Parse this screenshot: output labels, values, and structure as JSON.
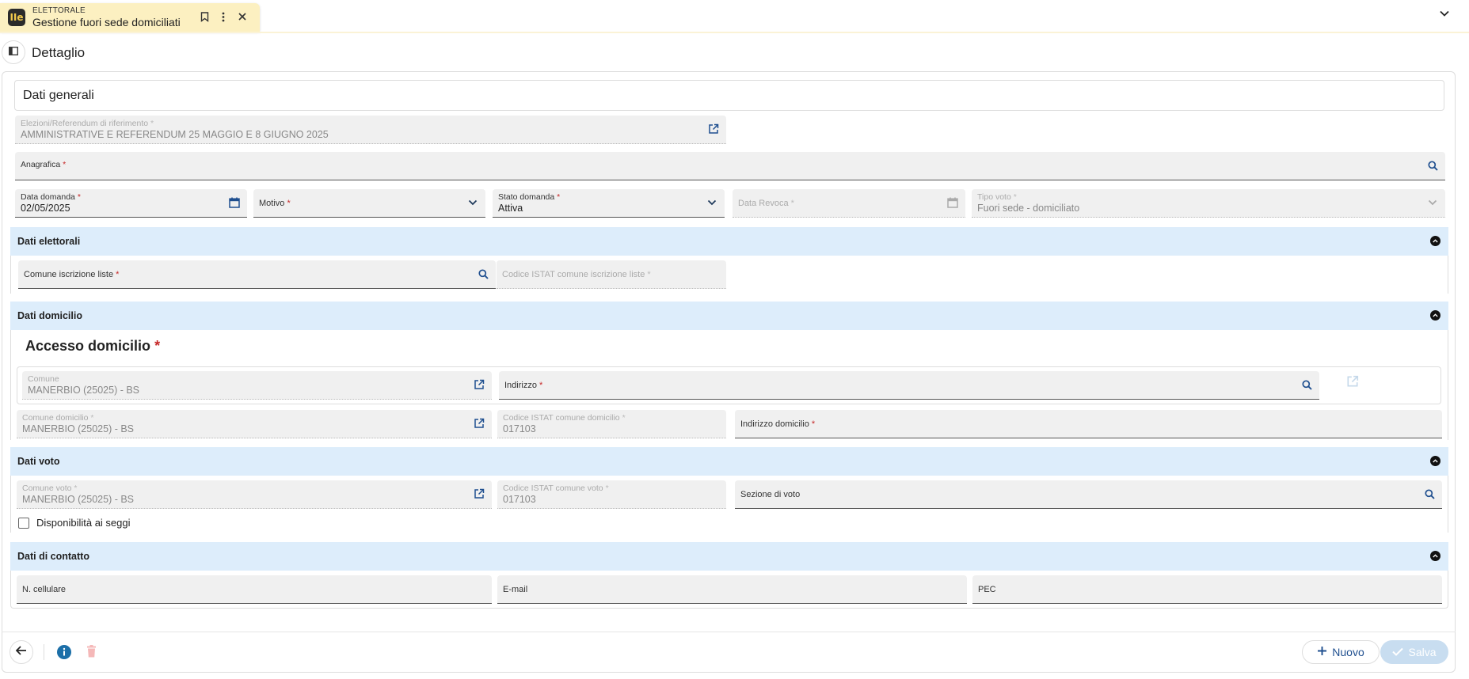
{
  "tab": {
    "category": "ELETTORALE",
    "title": "Gestione fuori sede domiciliati",
    "logo_text": "IIe"
  },
  "header": {
    "title": "Dettaglio"
  },
  "dati_generali": {
    "title": "Dati generali",
    "elezioni": {
      "label": "Elezioni/Referendum di riferimento",
      "value": "AMMINISTRATIVE E REFERENDUM 25 MAGGIO E 8 GIUGNO 2025"
    },
    "anagrafica": {
      "label": "Anagrafica"
    },
    "data_domanda": {
      "label": "Data domanda",
      "value": "02/05/2025"
    },
    "motivo": {
      "label": "Motivo"
    },
    "stato_domanda": {
      "label": "Stato domanda",
      "value": "Attiva"
    },
    "data_revoca": {
      "label": "Data Revoca"
    },
    "tipo_voto": {
      "label": "Tipo voto",
      "value": "Fuori sede - domiciliato"
    }
  },
  "dati_elettorali": {
    "title": "Dati elettorali",
    "comune_iscrizione": {
      "label": "Comune iscrizione liste"
    },
    "codice_istat_iscrizione": {
      "label": "Codice ISTAT comune iscrizione liste"
    }
  },
  "dati_domicilio": {
    "title": "Dati domicilio",
    "accesso_title": "Accesso domicilio",
    "comune": {
      "label": "Comune",
      "value": "MANERBIO (25025) - BS"
    },
    "indirizzo": {
      "label": "Indirizzo"
    },
    "comune_domicilio": {
      "label": "Comune domicilio",
      "value": "MANERBIO (25025) - BS"
    },
    "codice_istat_domicilio": {
      "label": "Codice ISTAT comune domicilio",
      "value": "017103"
    },
    "indirizzo_domicilio": {
      "label": "Indirizzo domicilio"
    }
  },
  "dati_voto": {
    "title": "Dati voto",
    "comune_voto": {
      "label": "Comune voto",
      "value": "MANERBIO (25025) - BS"
    },
    "codice_istat_voto": {
      "label": "Codice ISTAT comune voto",
      "value": "017103"
    },
    "sezione_voto": {
      "label": "Sezione di voto"
    },
    "disponibilita": {
      "label": "Disponibilità ai seggi",
      "checked": false
    }
  },
  "dati_contatto": {
    "title": "Dati di contatto",
    "cellulare": {
      "label": "N. cellulare"
    },
    "email": {
      "label": "E-mail"
    },
    "pec": {
      "label": "PEC"
    }
  },
  "footer": {
    "new_label": "Nuovo",
    "save_label": "Salva"
  },
  "required_marker": "*",
  "colors": {
    "tab_bg": "#fcf0c1",
    "section_bg": "#ddedfb",
    "accent": "#1f4f8f",
    "required": "#c62828",
    "info": "#1c6fa8",
    "delete_disabled": "#f5b8b8"
  },
  "icons": [
    "bookmark-icon",
    "more-vert-icon",
    "close-icon",
    "chevron-down-icon",
    "panel-toggle-icon",
    "open-in-new-icon",
    "search-icon",
    "calendar-icon",
    "collapse-icon",
    "arrow-back-icon",
    "info-icon",
    "trash-icon",
    "plus-icon",
    "check-icon"
  ]
}
